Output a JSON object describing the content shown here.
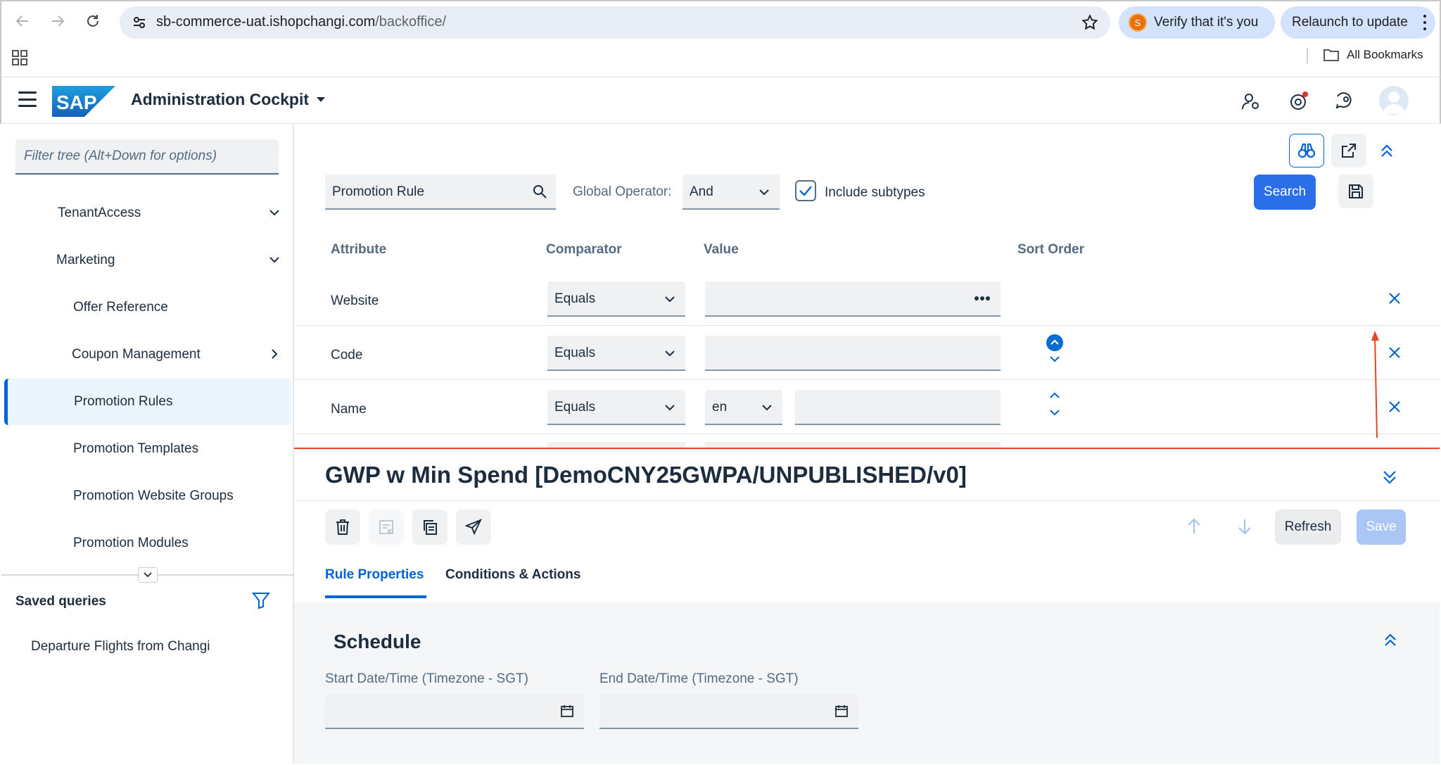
{
  "browser": {
    "url_host": "sb-commerce-uat.ishopchangi.com",
    "url_path": "/backoffice/",
    "verify_label": "Verify that it's you",
    "verify_avatar_letter": "S",
    "relaunch_label": "Relaunch to update",
    "all_bookmarks_label": "All Bookmarks"
  },
  "shell": {
    "logo_text": "SAP",
    "title": "Administration Cockpit"
  },
  "sidebar": {
    "filter_placeholder": "Filter tree (Alt+Down for options)",
    "items": [
      {
        "label": "TenantAccess"
      },
      {
        "label": "Marketing"
      },
      {
        "label": "Offer Reference"
      },
      {
        "label": "Coupon Management"
      },
      {
        "label": "Promotion Rules"
      },
      {
        "label": "Promotion Templates"
      },
      {
        "label": "Promotion Website Groups"
      },
      {
        "label": "Promotion Modules"
      }
    ],
    "saved_queries_title": "Saved queries",
    "saved_queries": [
      {
        "label": "Departure Flights from Changi"
      }
    ]
  },
  "search": {
    "type_value": "Promotion Rule",
    "global_operator_label": "Global Operator:",
    "global_operator_value": "And",
    "include_subtypes_label": "Include subtypes",
    "include_subtypes_checked": true,
    "search_button": "Search",
    "columns": [
      "Attribute",
      "Comparator",
      "Value",
      "Sort Order"
    ],
    "rows": [
      {
        "attribute": "Website",
        "comparator": "Equals",
        "value": ""
      },
      {
        "attribute": "Code",
        "comparator": "Equals",
        "value": ""
      },
      {
        "attribute": "Name",
        "comparator": "Equals",
        "lang": "en",
        "value": ""
      }
    ]
  },
  "editor": {
    "title": "GWP w Min Spend [DemoCNY25GWPA/UNPUBLISHED/v0]",
    "refresh_label": "Refresh",
    "save_label": "Save",
    "tabs": [
      {
        "label": "Rule Properties",
        "active": true
      },
      {
        "label": "Conditions & Actions",
        "active": false
      }
    ],
    "section_title": "Schedule",
    "start_label": "Start Date/Time (Timezone - SGT)",
    "end_label": "End Date/Time (Timezone - SGT)"
  },
  "colors": {
    "accent": "#0064d9",
    "primary_button": "#2b6fe8",
    "marker_line": "#e8431f"
  }
}
